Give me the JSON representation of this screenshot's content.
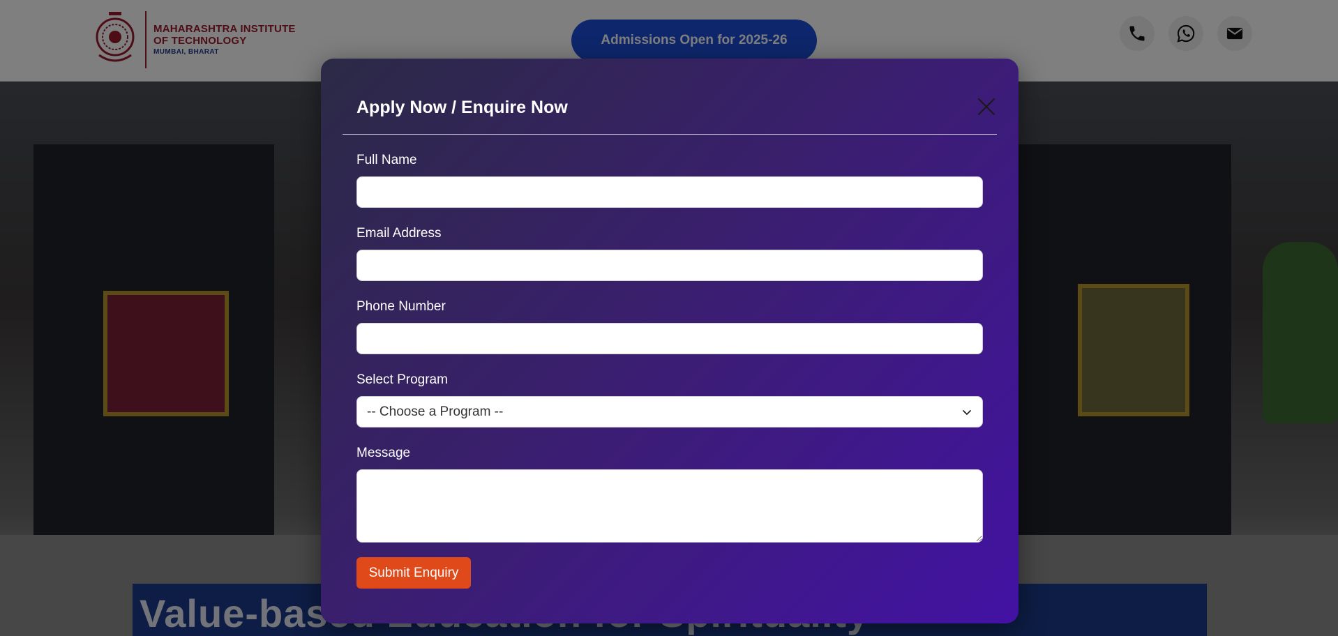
{
  "header": {
    "logo": {
      "line1": "MAHARASHTRA INSTITUTE",
      "line2": "OF TECHNOLOGY",
      "line3": "MUMBAI, BHARAT"
    },
    "admission_label": "Admissions Open for 2025-26",
    "contact_icons": [
      "phone-icon",
      "whatsapp-icon",
      "mail-icon"
    ]
  },
  "hero": {
    "title_text": "Value-based Education for Spirituality"
  },
  "modal": {
    "title": "Apply Now / Enquire Now",
    "fields": {
      "full_name": {
        "label": "Full Name",
        "value": ""
      },
      "email": {
        "label": "Email Address",
        "value": ""
      },
      "phone": {
        "label": "Phone Number",
        "value": ""
      },
      "program": {
        "label": "Select Program",
        "selected": "-- Choose a Program --"
      },
      "message": {
        "label": "Message",
        "value": ""
      }
    },
    "submit_label": "Submit Enquiry"
  },
  "colors": {
    "brand_red": "#9b1b2e",
    "brand_blue": "#1d4ed8",
    "modal_gradient_start": "#2b2a45",
    "modal_gradient_end": "#4312a3",
    "submit_orange": "#e04a1a"
  }
}
